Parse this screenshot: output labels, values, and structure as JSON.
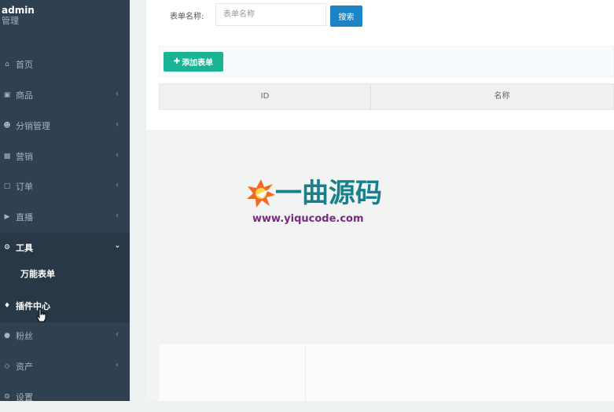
{
  "user": {
    "name": "admin",
    "role": "管理"
  },
  "sidebar": {
    "items": [
      {
        "label": "首页",
        "icon": "home-icon",
        "has_chevron": false
      },
      {
        "label": "商品",
        "icon": "book-icon",
        "has_chevron": true
      },
      {
        "label": "分销管理",
        "icon": "users-icon",
        "has_chevron": true
      },
      {
        "label": "营销",
        "icon": "gift-icon",
        "has_chevron": true
      },
      {
        "label": "订单",
        "icon": "briefcase-icon",
        "has_chevron": true
      },
      {
        "label": "直播",
        "icon": "video-camera-icon",
        "has_chevron": true
      },
      {
        "label": "工具",
        "icon": "cog-icon",
        "has_chevron": true,
        "expanded": true
      },
      {
        "label": "插件中心",
        "icon": "puzzle-icon",
        "has_chevron": false
      },
      {
        "label": "粉丝",
        "icon": "user-icon",
        "has_chevron": true
      },
      {
        "label": "资产",
        "icon": "diamond-icon",
        "has_chevron": true
      },
      {
        "label": "设置",
        "icon": "gear-icon",
        "has_chevron": false
      }
    ],
    "submenu": {
      "label": "万能表单"
    }
  },
  "search": {
    "label": "表单名称:",
    "placeholder": "表单名称",
    "button": "搜索"
  },
  "toolbar": {
    "add_label": "添加表单"
  },
  "table": {
    "columns": [
      "ID",
      "名称"
    ]
  },
  "watermark": {
    "text": "一曲源码",
    "url": "www.yiqucode.com"
  },
  "colors": {
    "sidebar": "#2f4050",
    "primary": "#1c84c6",
    "success": "#1ab394"
  }
}
